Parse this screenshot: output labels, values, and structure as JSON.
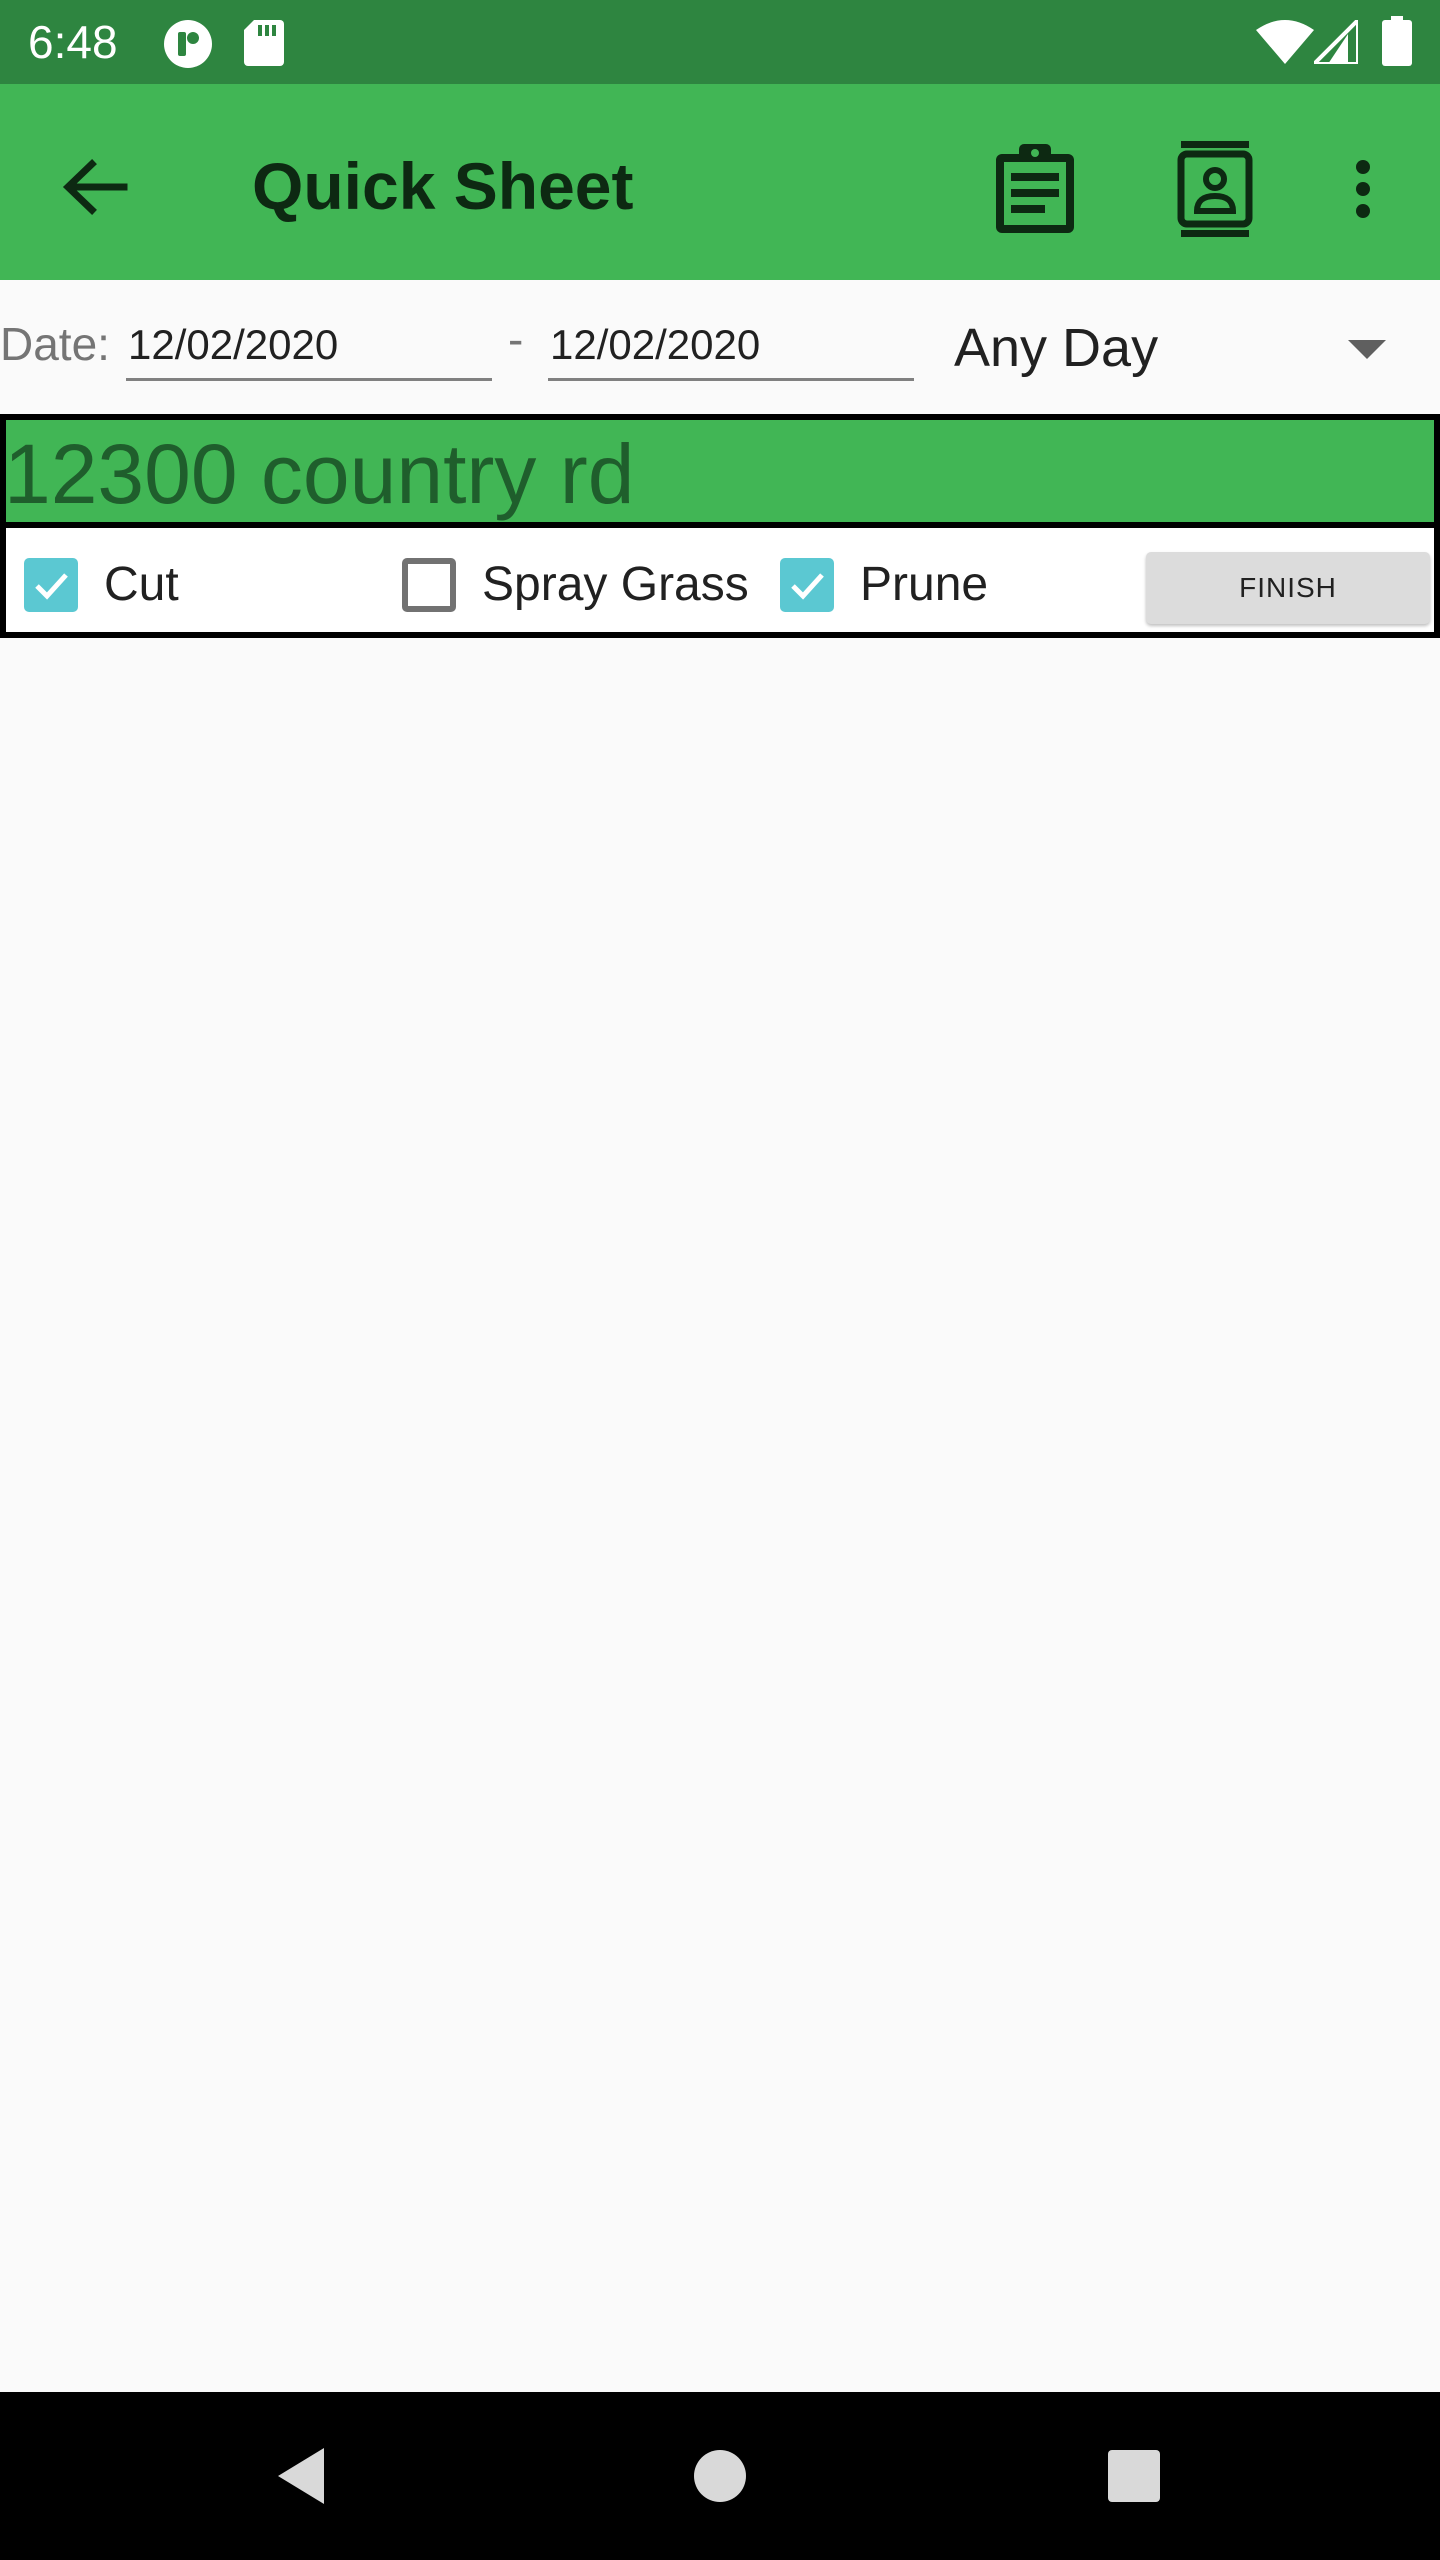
{
  "status_bar": {
    "time": "6:48",
    "icons": [
      "record-badge-icon",
      "sd-card-icon",
      "wifi-icon",
      "cell-signal-icon",
      "battery-icon"
    ]
  },
  "app_bar": {
    "title": "Quick Sheet",
    "back_icon": "arrow-back-icon",
    "actions": [
      "clipboard-list-icon",
      "contact-card-icon",
      "more-vert-icon"
    ],
    "color": "#41b655"
  },
  "filters": {
    "date_label": "Date:",
    "start_date": "12/02/2020",
    "separator": "-",
    "end_date": "12/02/2020",
    "day_option": "Any Day"
  },
  "jobs": [
    {
      "address": "12300 country rd",
      "tasks": [
        {
          "label": "Cut",
          "checked": true
        },
        {
          "label": "Spray Grass",
          "checked": false
        },
        {
          "label": "Prune",
          "checked": true
        }
      ],
      "finish_label": "FINISH"
    }
  ],
  "colors": {
    "status_bar": "#2e8540",
    "accent": "#41b655",
    "checkbox_checked": "#5bc8d2"
  },
  "nav_bar": {
    "buttons": [
      "nav-back-icon",
      "nav-home-icon",
      "nav-recents-icon"
    ]
  }
}
